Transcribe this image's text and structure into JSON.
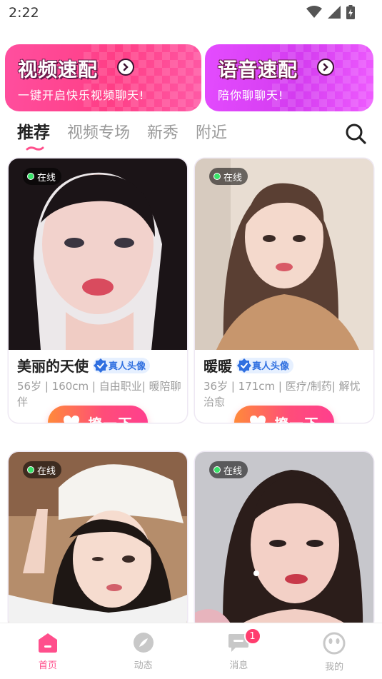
{
  "status_bar": {
    "time": "2:22"
  },
  "banners": {
    "video": {
      "title": "视频速配",
      "subtitle": "一键开启快乐视频聊天!"
    },
    "voice": {
      "title": "语音速配",
      "subtitle": "陪你聊聊天!"
    }
  },
  "tabs": [
    "推荐",
    "视频专场",
    "新秀",
    "附近"
  ],
  "cards": [
    {
      "online": "在线",
      "name": "美丽的天使",
      "verified": "真人头像",
      "info": "56岁 | 160cm | 自由职业| 暖陪聊伴",
      "action": "撩一下"
    },
    {
      "online": "在线",
      "name": "暖暖",
      "verified": "真人头像",
      "info": "36岁 | 171cm | 医疗/制药| 解忧治愈",
      "action": "撩一下"
    },
    {
      "online": "在线"
    },
    {
      "online": "在线"
    }
  ],
  "nav": [
    {
      "label": "首页"
    },
    {
      "label": "动态"
    },
    {
      "label": "消息",
      "badge": "1"
    },
    {
      "label": "我的"
    }
  ],
  "colors": {
    "accent": "#ff4f8c",
    "online": "#39e36a",
    "verify": "#2f6fe0"
  }
}
